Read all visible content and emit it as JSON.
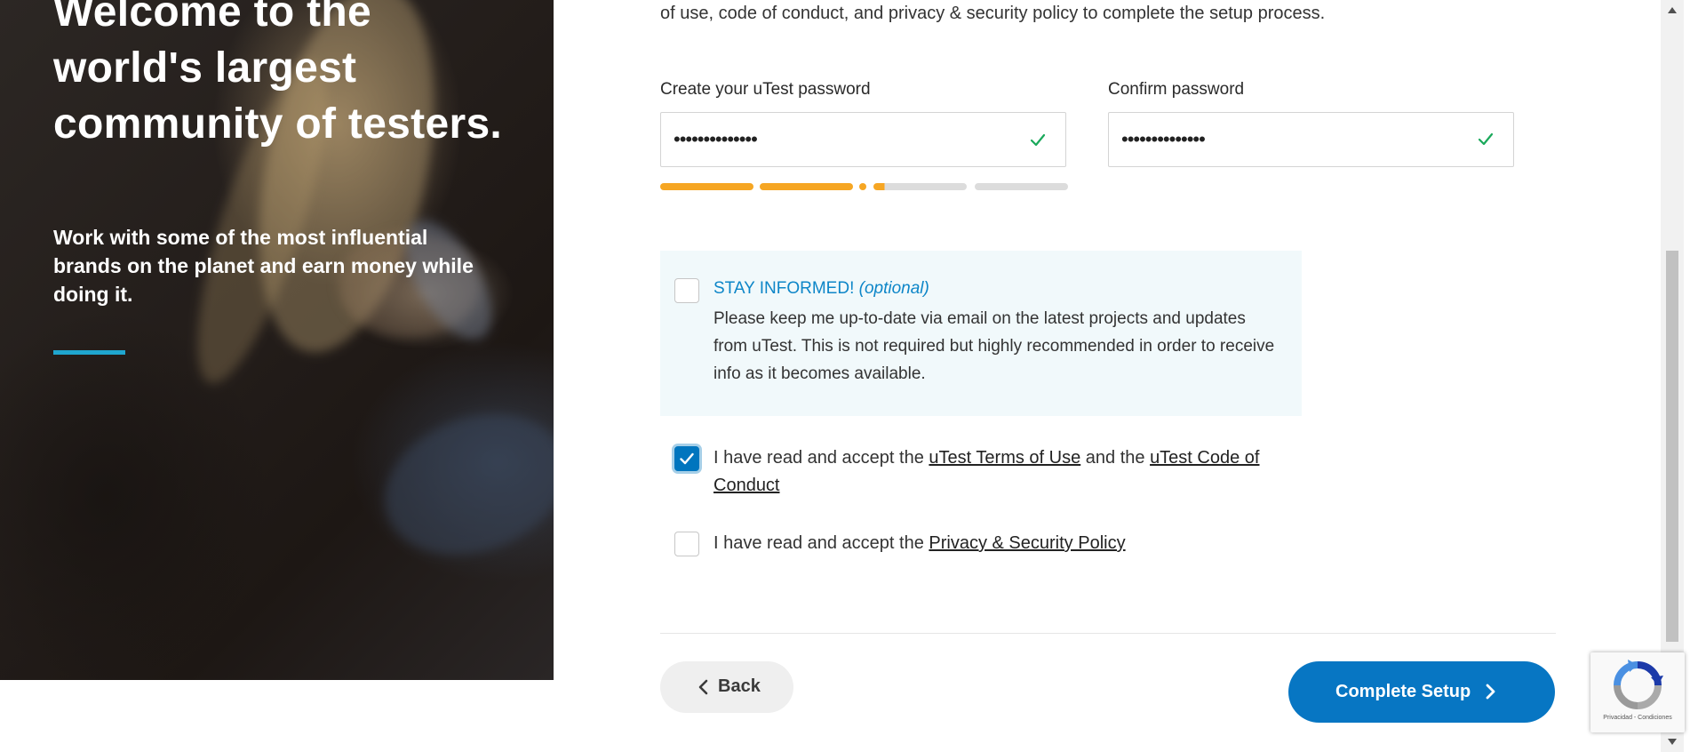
{
  "hero": {
    "title": "Welcome to the world's largest community of testers.",
    "subtitle": "Work with some of the most influential brands on the planet and earn money while doing it."
  },
  "form": {
    "intro_text": "of use, code of conduct, and privacy & security policy to complete the setup process.",
    "password_label": "Create your uTest password",
    "password_value": "••••••••••••••",
    "confirm_label": "Confirm password",
    "confirm_value": "••••••••••••••",
    "strength_fraction": 0.55,
    "optin": {
      "title": "STAY INFORMED!",
      "optional": "(optional)",
      "body": "Please keep me up-to-date via email on the latest projects and updates from uTest. This is not required but highly recommended in order to receive info as it becomes available.",
      "checked": false
    },
    "terms": {
      "prefix": "I have read and accept the ",
      "terms_link": "uTest Terms of Use",
      "middle": " and the ",
      "conduct_link": "uTest Code of Conduct",
      "checked": true
    },
    "privacy": {
      "prefix": "I have read and accept the ",
      "privacy_link": "Privacy & Security Policy",
      "checked": false
    },
    "back_label": "Back",
    "complete_label": "Complete Setup"
  },
  "recaptcha": {
    "links": "Privacidad - Condiciones"
  },
  "colors": {
    "primary": "#0776c3",
    "accent": "#1fa6cf",
    "strength_fill": "#f6a623",
    "valid_check": "#1aa95b",
    "optin_title": "#0d86c8"
  },
  "icons": {
    "password_valid": "check-icon",
    "confirm_valid": "check-icon",
    "back": "chevron-left-icon",
    "complete": "chevron-right-icon",
    "recaptcha": "recaptcha-logo-icon"
  }
}
